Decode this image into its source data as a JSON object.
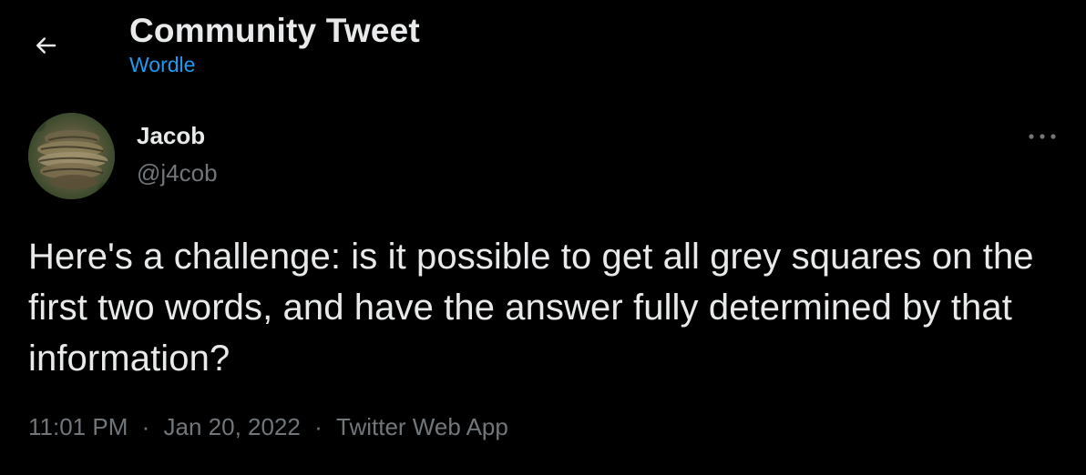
{
  "header": {
    "title": "Community Tweet",
    "subtitle": "Wordle"
  },
  "author": {
    "display_name": "Jacob",
    "handle": "@j4cob"
  },
  "tweet": {
    "text": "Here's a challenge: is it possible to get all grey squares on the first two words, and have the answer fully determined by that information?"
  },
  "meta": {
    "time": "11:01 PM",
    "separator_1": "·",
    "date": "Jan 20, 2022",
    "separator_2": "·",
    "source": "Twitter Web App"
  },
  "icons": {
    "back": "arrow-left-icon",
    "more": "more-horizontal-icon"
  },
  "colors": {
    "background": "#000000",
    "primary_text": "#e7e9ea",
    "secondary_text": "#71767b",
    "accent": "#1d9bf0"
  }
}
